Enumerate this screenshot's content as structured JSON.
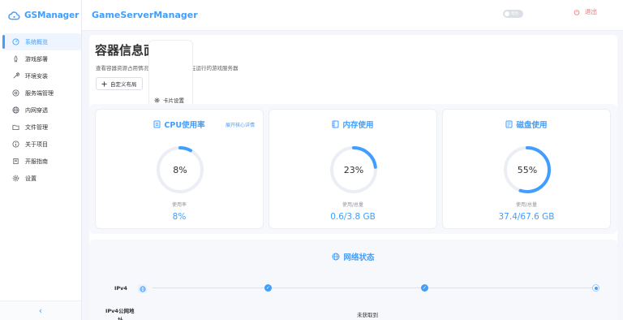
{
  "app": {
    "brand": "GSManager",
    "title": "GameServerManager",
    "theme_label": "暗色",
    "logout_label": "退出"
  },
  "sidebar": {
    "items": [
      {
        "label": "系统概览",
        "icon": "dashboard-icon",
        "active": true
      },
      {
        "label": "游戏部署",
        "icon": "rocket-icon"
      },
      {
        "label": "环境安装",
        "icon": "wrench-icon"
      },
      {
        "label": "服务端管理",
        "icon": "server-icon"
      },
      {
        "label": "内网穿透",
        "icon": "globe-icon"
      },
      {
        "label": "文件管理",
        "icon": "folder-icon"
      },
      {
        "label": "关于项目",
        "icon": "info-icon"
      },
      {
        "label": "开服指南",
        "icon": "book-icon"
      },
      {
        "label": "设置",
        "icon": "gear-icon"
      }
    ],
    "collapse_glyph": "‹"
  },
  "page": {
    "title": "容器信息面板",
    "description": "查看容器资源占用情况，已安装游戏和正在运行的游戏服务器",
    "custom_layout_label": "自定义布局",
    "card_settings_label": "卡片设置"
  },
  "cards": [
    {
      "title": "CPU使用率",
      "gauge_text": "8%",
      "percent": 8,
      "sub": "使用率",
      "value": "8%",
      "link": "展开核心详情"
    },
    {
      "title": "内存使用",
      "gauge_text": "23%",
      "percent": 23,
      "sub": "使用/总量",
      "value": "0.6/3.8 GB"
    },
    {
      "title": "磁盘使用",
      "gauge_text": "55%",
      "percent": 55,
      "sub": "使用/总量",
      "value": "37.4/67.6 GB"
    }
  ],
  "network": {
    "title": "网络状态",
    "ipv4_label": "IPv4",
    "ipv4_public_label_line1": "IPv4公网地",
    "ipv4_public_label_line2": "址",
    "ipv4_public_value": "未获取到"
  },
  "colors": {
    "accent": "#409eff",
    "danger": "#f56c6c",
    "track": "#ebeef5"
  }
}
